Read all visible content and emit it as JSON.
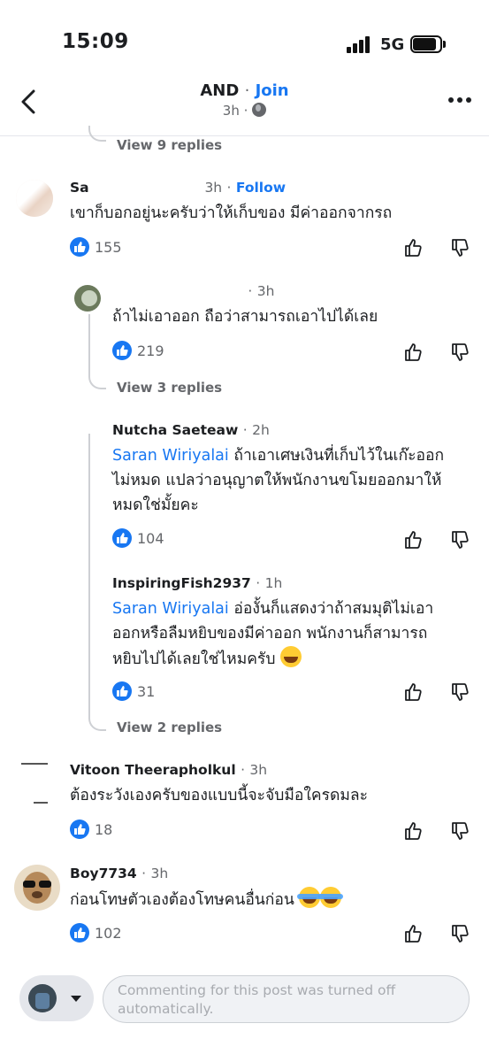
{
  "status_bar": {
    "time": "15:09",
    "network": "5G"
  },
  "header": {
    "group_name": "AND",
    "separator": "·",
    "join_label": "Join",
    "time_ago": "3h",
    "sub_separator": "·"
  },
  "top_view_replies": "View 9 replies",
  "comments": [
    {
      "name": "Sa",
      "time": "3h",
      "follow": "Follow",
      "text": "เขาก็บอกอยู่นะครับว่าให้เก็บของ มีค่าออกจากรถ",
      "likes": "155"
    },
    {
      "name": "",
      "time": "3h",
      "text": "ถ้าไม่เอาออก ถือว่าสามารถเอาไปได้เลย",
      "likes": "219",
      "view_replies": "View 3 replies"
    },
    {
      "name": "Nutcha Saeteaw",
      "time": "2h",
      "mention": "Saran Wiriyalai",
      "text_line1": " ถ้าเอาเศษเงินที่เก็บไว้ในเก๊ะออก",
      "text_line2": "ไม่หมด แปลว่าอนุญาตให้พนักงานขโมยออกมาให้",
      "text_line3": "หมดใช่มั้ยคะ",
      "likes": "104"
    },
    {
      "name": "InspiringFish2937",
      "time": "1h",
      "mention": "Saran Wiriyalai",
      "text_line1": " อ่องั้นก็แสดงว่าถ้าสมมุติไม่เอา",
      "text_line2": "ออกหรือลืมหยิบของมีค่าออก พนักงานก็สามารถ",
      "text_line3": "หยิบไปได้เลยใช่ไหมครับ",
      "likes": "31",
      "view_replies": "View 2 replies"
    },
    {
      "name": "Vitoon Theerapholkul",
      "time": "3h",
      "text": "ต้องระวังเองครับของแบบนี้จะจับมือใครดมละ",
      "likes": "18"
    },
    {
      "name": "Boy7734",
      "time": "3h",
      "text": "ก่อนโทษตัวเองต้องโทษคนอื่นก่อน",
      "likes": "102"
    }
  ],
  "composer": {
    "placeholder": "Commenting for this post was turned off automatically."
  },
  "icons": {
    "back": "chevron-left-icon",
    "more": "more-dots-icon",
    "globe": "globe-icon",
    "like_badge": "like-badge-icon",
    "upvote": "thumbs-up-icon",
    "downvote": "thumbs-down-icon"
  },
  "colors": {
    "accent": "#1877f2",
    "secondary_text": "#65676b",
    "thread_line": "#ced0d4"
  }
}
